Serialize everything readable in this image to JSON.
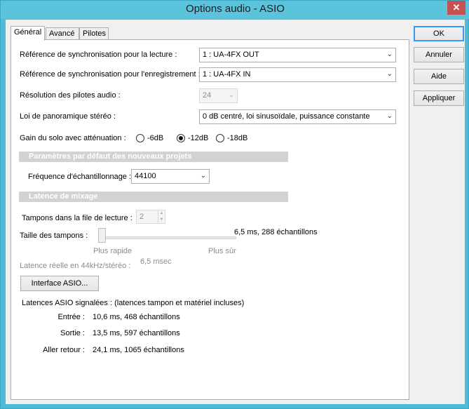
{
  "window": {
    "title": "Options audio - ASIO"
  },
  "tabs": [
    {
      "label": "Général"
    },
    {
      "label": "Avancé"
    },
    {
      "label": "Pilotes"
    }
  ],
  "buttons": {
    "ok": "OK",
    "cancel": "Annuler",
    "help": "Aide",
    "apply": "Appliquer"
  },
  "general": {
    "playback_sync": {
      "label": "Référence de synchronisation pour la lecture :",
      "value": "1 : UA-4FX OUT"
    },
    "record_sync": {
      "label": "Référence de synchronisation pour l'enregistrement :",
      "value": "1 : UA-4FX IN"
    },
    "driver_resolution": {
      "label": "Résolution des pilotes audio :",
      "value": "24"
    },
    "pan_law": {
      "label": "Loi de panoramique stéréo :",
      "value": "0 dB centré, loi sinusoïdale, puissance constante"
    },
    "solo_gain": {
      "label": "Gain du solo avec atténuation :",
      "options": [
        "-6dB",
        "-12dB",
        "-18dB"
      ],
      "selected": "-12dB"
    }
  },
  "defaults_section": {
    "header": "Paramètres par défaut des nouveaux projets",
    "sample_rate": {
      "label": "Fréquence d'échantillonnage :",
      "value": "44100"
    }
  },
  "latency_section": {
    "header": "Latence de mixage",
    "buffers_in_queue": {
      "label": "Tampons dans la file de lecture :",
      "value": "2"
    },
    "buffer_size": {
      "label": "Taille des tampons :",
      "value_text": "6,5 ms, 288 échantillons",
      "slider_level": 0.0
    },
    "slider_left": "Plus rapide",
    "slider_right": "Plus sûr",
    "effective": {
      "label": "Latence réelle en 44kHz/stéréo :",
      "value": "6,5 msec"
    },
    "asio_button": "Interface ASIO...",
    "reported": {
      "heading": "Latences ASIO signalées : (latences tampon et matériel incluses)",
      "rows": [
        {
          "label": "Entrée :",
          "value": "10,6 ms, 468 échantillons"
        },
        {
          "label": "Sortie :",
          "value": "13,5 ms, 597 échantillons"
        },
        {
          "label": "Aller retour :",
          "value": "24,1 ms, 1065 échantillons"
        }
      ]
    }
  }
}
